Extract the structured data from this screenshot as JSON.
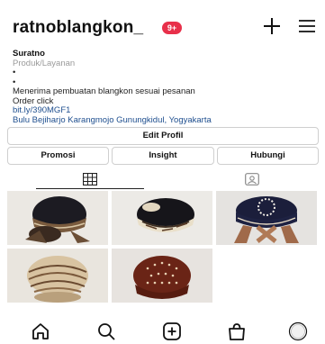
{
  "header": {
    "username": "ratnoblangkon_",
    "notification_badge": "9+",
    "icons": [
      "plus-icon",
      "menu-icon"
    ]
  },
  "bio": {
    "name": "Suratno",
    "category": "Produk/Layanan",
    "line_dot_1": "•",
    "line_dot_2": "•",
    "description": "Menerima pembuatan blangkon sesuai pesanan",
    "order": "Order click",
    "link": "bit.ly/390MGF1",
    "location": "Bulu Bejiharjo Karangmojo Gunungkidul, Yogyakarta"
  },
  "buttons": {
    "edit_profile": "Edit Profil",
    "promosi": "Promosi",
    "insight": "Insight",
    "hubungi": "Hubungi"
  },
  "tabs": [
    {
      "icon": "grid-icon",
      "active": true
    },
    {
      "icon": "tagged-icon",
      "active": false
    }
  ],
  "posts": [
    {
      "icon": "blangkon-photo"
    },
    {
      "icon": "blangkon-photo"
    },
    {
      "icon": "blangkon-photo"
    },
    {
      "icon": "blangkon-photo"
    },
    {
      "icon": "blangkon-photo"
    }
  ],
  "bottom_nav": [
    "home-icon",
    "search-icon",
    "add-post-icon",
    "shop-icon",
    "profile-icon"
  ],
  "colors": {
    "badge": "#e8304a",
    "link": "#1f4f8f",
    "category": "#9a9a9a",
    "button_border": "#cfcfcf"
  }
}
